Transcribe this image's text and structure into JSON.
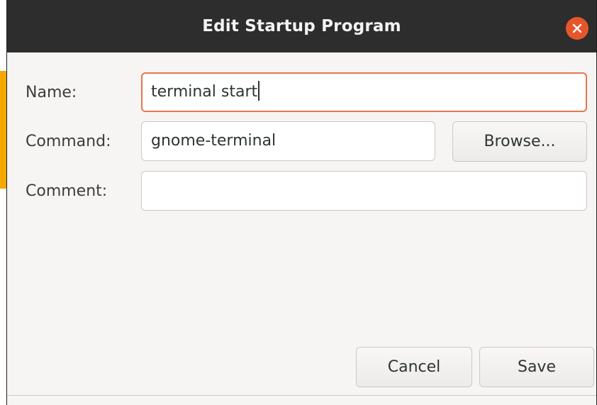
{
  "dialog": {
    "title": "Edit Startup Program",
    "close_icon": "close-icon"
  },
  "form": {
    "name_label": "Name:",
    "name_value": "terminal start",
    "command_label": "Command:",
    "command_value": "gnome-terminal",
    "browse_label": "Browse...",
    "comment_label": "Comment:",
    "comment_value": ""
  },
  "actions": {
    "cancel_label": "Cancel",
    "save_label": "Save"
  },
  "colors": {
    "titlebar": "#2d2d2d",
    "close_button": "#e9552b",
    "focus_ring": "#e9764e",
    "background_accent": "#f5a800"
  }
}
